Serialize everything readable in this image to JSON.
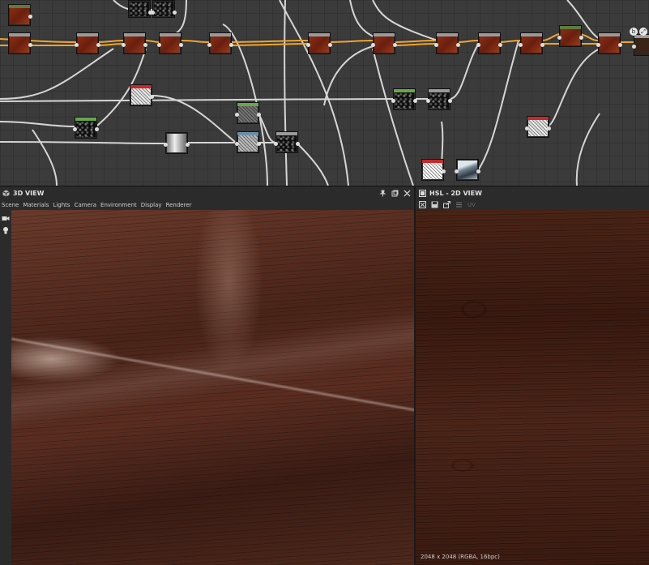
{
  "panels": {
    "view3d": {
      "title": "3D VIEW",
      "icon": "cube-icon",
      "menu": [
        "Scene",
        "Materials",
        "Lights",
        "Camera",
        "Environment",
        "Display",
        "Renderer"
      ],
      "window_icons": [
        "pin-icon",
        "float-icon",
        "close-icon"
      ]
    },
    "view2d": {
      "title": "HSL - 2D VIEW",
      "icon": "image-panel-icon",
      "toolbar_icons": [
        "fit-view-icon",
        "save-icon",
        "export-icon",
        "tiling-icon"
      ],
      "uv_label": "UV",
      "resolution": "2048 x 2048 (RGBA, 16bpc)"
    },
    "sidebar_icons": [
      "camera-icon",
      "light-bulb-icon"
    ]
  },
  "graph": {
    "corner_buttons": [
      "bake-icon",
      "maximize-icon"
    ],
    "colors": {
      "wire_main": "#f0a52c",
      "wire_secondary": "#d8d8d8",
      "background": "#3b3b3b"
    }
  }
}
